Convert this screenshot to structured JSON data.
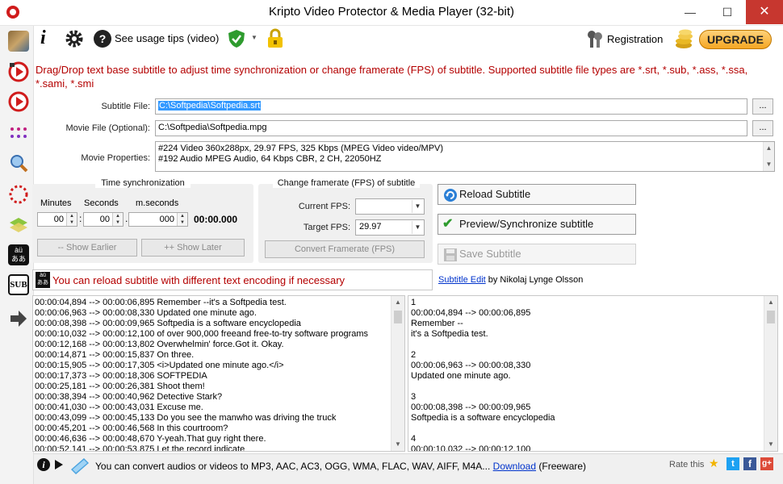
{
  "window": {
    "title": "Kripto Video Protector & Media Player (32-bit)",
    "minimize": "—",
    "maximize": "☐",
    "close": "✕"
  },
  "toolbar": {
    "usage_tips": "See usage tips (video)",
    "registration": "Registration",
    "upgrade": "UPGRADE"
  },
  "message": "Drag/Drop text base subtitle to adjust time synchronization or change framerate (FPS) of subtitle. Supported subtitle file types are *.srt, *.sub, *.ass, *.ssa, *.sami, *.smi",
  "form": {
    "subtitle_label": "Subtitle File:",
    "subtitle_value": "C:\\Softpedia\\Softpedia.srt",
    "movie_label": "Movie File (Optional):",
    "movie_value": "C:\\Softpedia\\Softpedia.mpg",
    "browse": "...",
    "properties_label": "Movie Properties:",
    "properties_line1": "#224 Video 360x288px, 29.97 FPS, 325 Kbps  (MPEG Video  video/MPV)",
    "properties_line2": "#192 Audio  MPEG Audio, 64 Kbps CBR, 2 CH, 22050HZ"
  },
  "time_sync": {
    "title": "Time synchronization",
    "minutes_label": "Minutes",
    "seconds_label": "Seconds",
    "ms_label": "m.seconds",
    "minutes": "00",
    "seconds": "00",
    "ms": "000",
    "sep_colon": ":",
    "sep_dot": ".",
    "total": "00:00.000",
    "show_earlier": "-- Show Earlier",
    "show_later": "++ Show Later"
  },
  "framerate": {
    "title": "Change framerate (FPS) of subtitle",
    "current_label": "Current FPS:",
    "current_value": "",
    "target_label": "Target FPS:",
    "target_value": "29.97",
    "convert": "Convert Framerate (FPS)"
  },
  "actions": {
    "reload": "Reload Subtitle",
    "preview": "Preview/Synchronize subtitle",
    "save": "Save Subtitle"
  },
  "encoding_msg": "You can reload subtitle with different text encoding if necessary",
  "credit": {
    "link": "Subtitle Edit",
    "text": " by Nikolaj Lynge Olsson"
  },
  "left_list": [
    "00:00:04,894 --> 00:00:06,895 Remember --it's a Softpedia test.",
    "00:00:06,963 --> 00:00:08,330 Updated one minute ago.",
    "00:00:08,398 --> 00:00:09,965 Softpedia is a software encyclopedia",
    "00:00:10,032 --> 00:00:12,100 of over 900,000 freeand free-to-try software programs",
    "00:00:12,168 --> 00:00:13,802 Overwhelmin' force.Got it. Okay.",
    "00:00:14,871 --> 00:00:15,837 On three.",
    "00:00:15,905 --> 00:00:17,305 <i>Updated one minute ago.</i>",
    "00:00:17,373 --> 00:00:18,306 SOFTPEDIA",
    "00:00:25,181 --> 00:00:26,381 Shoot them!",
    "00:00:38,394 --> 00:00:40,962 Detective Stark?",
    "00:00:41,030 --> 00:00:43,031 Excuse me.",
    "00:00:43,099 --> 00:00:45,133 Do you see the manwho was driving the truck",
    "00:00:45,201 --> 00:00:46,568 In this courtroom?",
    "00:00:46,636 --> 00:00:48,670 Y-yeah.That guy right there.",
    "00:00:52,141 --> 00:00:53,875 Let the record indicate"
  ],
  "right_list": [
    "1",
    "00:00:04,894 --> 00:00:06,895",
    "Remember --",
    "it's a Softpedia test.",
    "",
    "2",
    "00:00:06,963 --> 00:00:08,330",
    "Updated one minute ago.",
    "",
    "3",
    "00:00:08,398 --> 00:00:09,965",
    "Softpedia is a software encyclopedia",
    "",
    "4",
    "00:00:10,032 --> 00:00:12,100"
  ],
  "status": {
    "text": "You can convert audios or videos to MP3, AAC, AC3, OGG, WMA, FLAC, WAV, AIFF, M4A...",
    "download": "Download",
    "freeware": " (Freeware)",
    "rate": "Rate this"
  },
  "sidebar": {
    "sub_label": "SUB",
    "encoding_label": "àü\nああ"
  },
  "colors": {
    "message_red": "#b40000",
    "upgrade_orange": "#f5a623",
    "shield_green": "#2e9b2e",
    "twitter": "#1da1f2",
    "facebook": "#3b5998",
    "google": "#dd4b39"
  }
}
